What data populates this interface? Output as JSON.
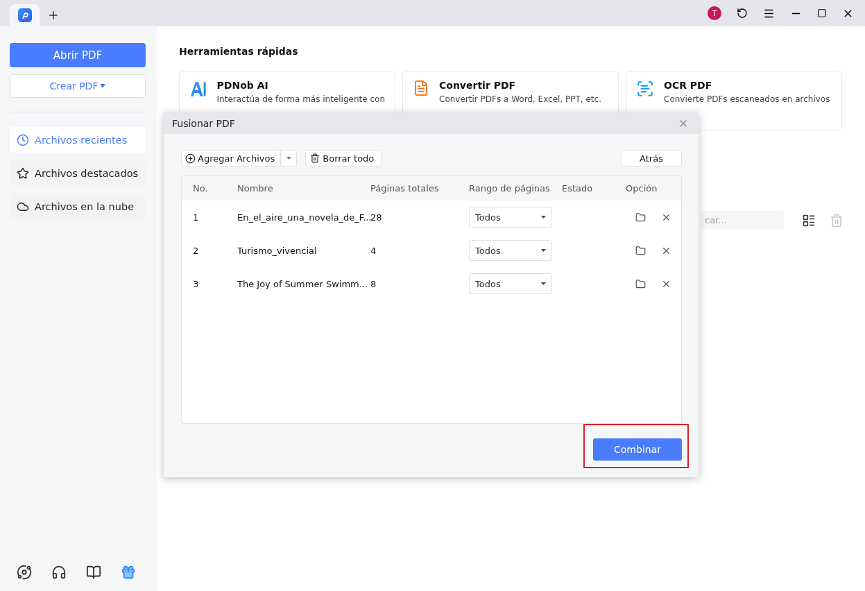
{
  "title_bar": {
    "avatar": "T"
  },
  "sidebar": {
    "open_button": "Abrir PDF",
    "create_button": "Crear PDF",
    "items": [
      {
        "label": "Archivos recientes",
        "selected": true
      },
      {
        "label": "Archivos destacados",
        "selected": false
      },
      {
        "label": "Archivos en la nube",
        "selected": false
      }
    ]
  },
  "main": {
    "heading": "Herramientas rápidas",
    "tools": [
      {
        "title": "PDNob AI",
        "description": "Interactúa de forma más inteligente con"
      },
      {
        "title": "Convertir PDF",
        "description": "Convertir PDFs a Word, Excel, PPT, etc."
      },
      {
        "title": "OCR PDF",
        "description": "Convierte PDFs escaneados en archivos"
      }
    ],
    "search": {
      "placeholder": "car..."
    }
  },
  "dialog": {
    "title": "Fusionar PDF",
    "add_button": "Agregar Archivos",
    "clear_button": "Borrar todo",
    "back_button": "Atrás",
    "table": {
      "columns": [
        "No.",
        "Nombre",
        "Páginas totales",
        "Rango de páginas",
        "Estado",
        "Opción"
      ],
      "rows": [
        {
          "no": "1",
          "name": "En_el_aire_una_novela_de_F...",
          "pages": "28",
          "range": "Todos"
        },
        {
          "no": "2",
          "name": "Turismo_vivencial",
          "pages": "4",
          "range": "Todos"
        },
        {
          "no": "3",
          "name": "The Joy of Summer Swimm...",
          "pages": "8",
          "range": "Todos"
        }
      ]
    },
    "combine_button": "Combinar"
  }
}
